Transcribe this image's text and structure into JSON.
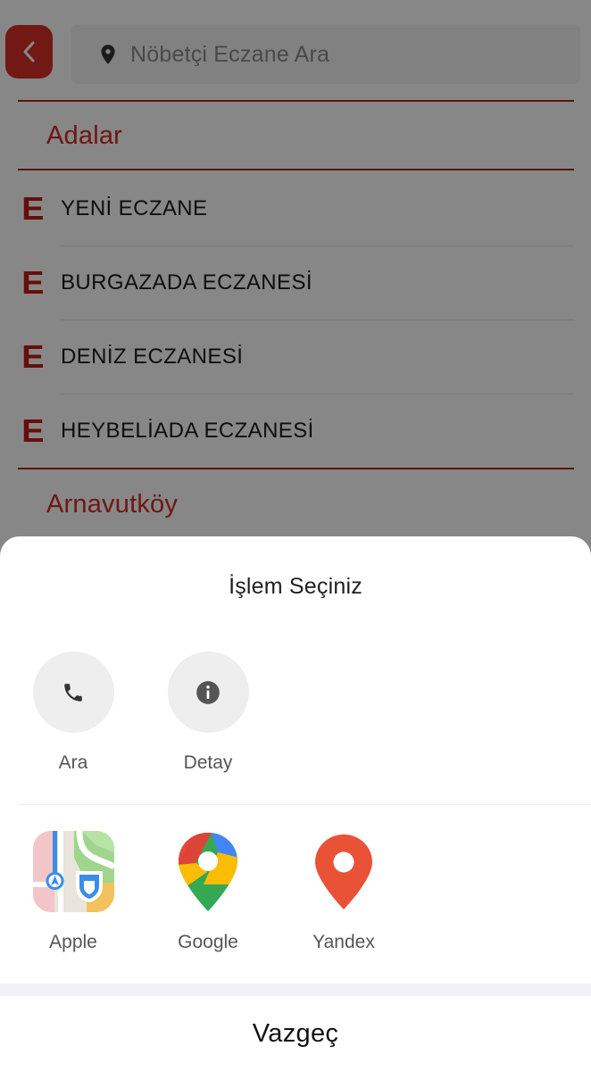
{
  "search": {
    "placeholder": "Nöbetçi Eczane Ara"
  },
  "districts": [
    {
      "name": "Adalar",
      "pharmacies": [
        "YENİ ECZANE",
        "BURGAZADA ECZANESİ",
        "DENİZ ECZANESİ",
        "HEYBELİADA ECZANESİ"
      ]
    },
    {
      "name": "Arnavutköy",
      "pharmacies": []
    }
  ],
  "badge_letter": "E",
  "sheet": {
    "title": "İşlem Seçiniz",
    "actions": [
      {
        "label": "Ara",
        "icon": "phone-icon"
      },
      {
        "label": "Detay",
        "icon": "info-icon"
      }
    ],
    "map_apps": [
      {
        "label": "Apple",
        "icon": "apple-maps-icon"
      },
      {
        "label": "Google",
        "icon": "google-maps-icon"
      },
      {
        "label": "Yandex",
        "icon": "yandex-maps-icon"
      }
    ],
    "cancel_label": "Vazgeç"
  },
  "colors": {
    "accent": "#d32a25",
    "badge": "#c01b16",
    "overlay": "rgba(0,0,0,0.47)"
  }
}
